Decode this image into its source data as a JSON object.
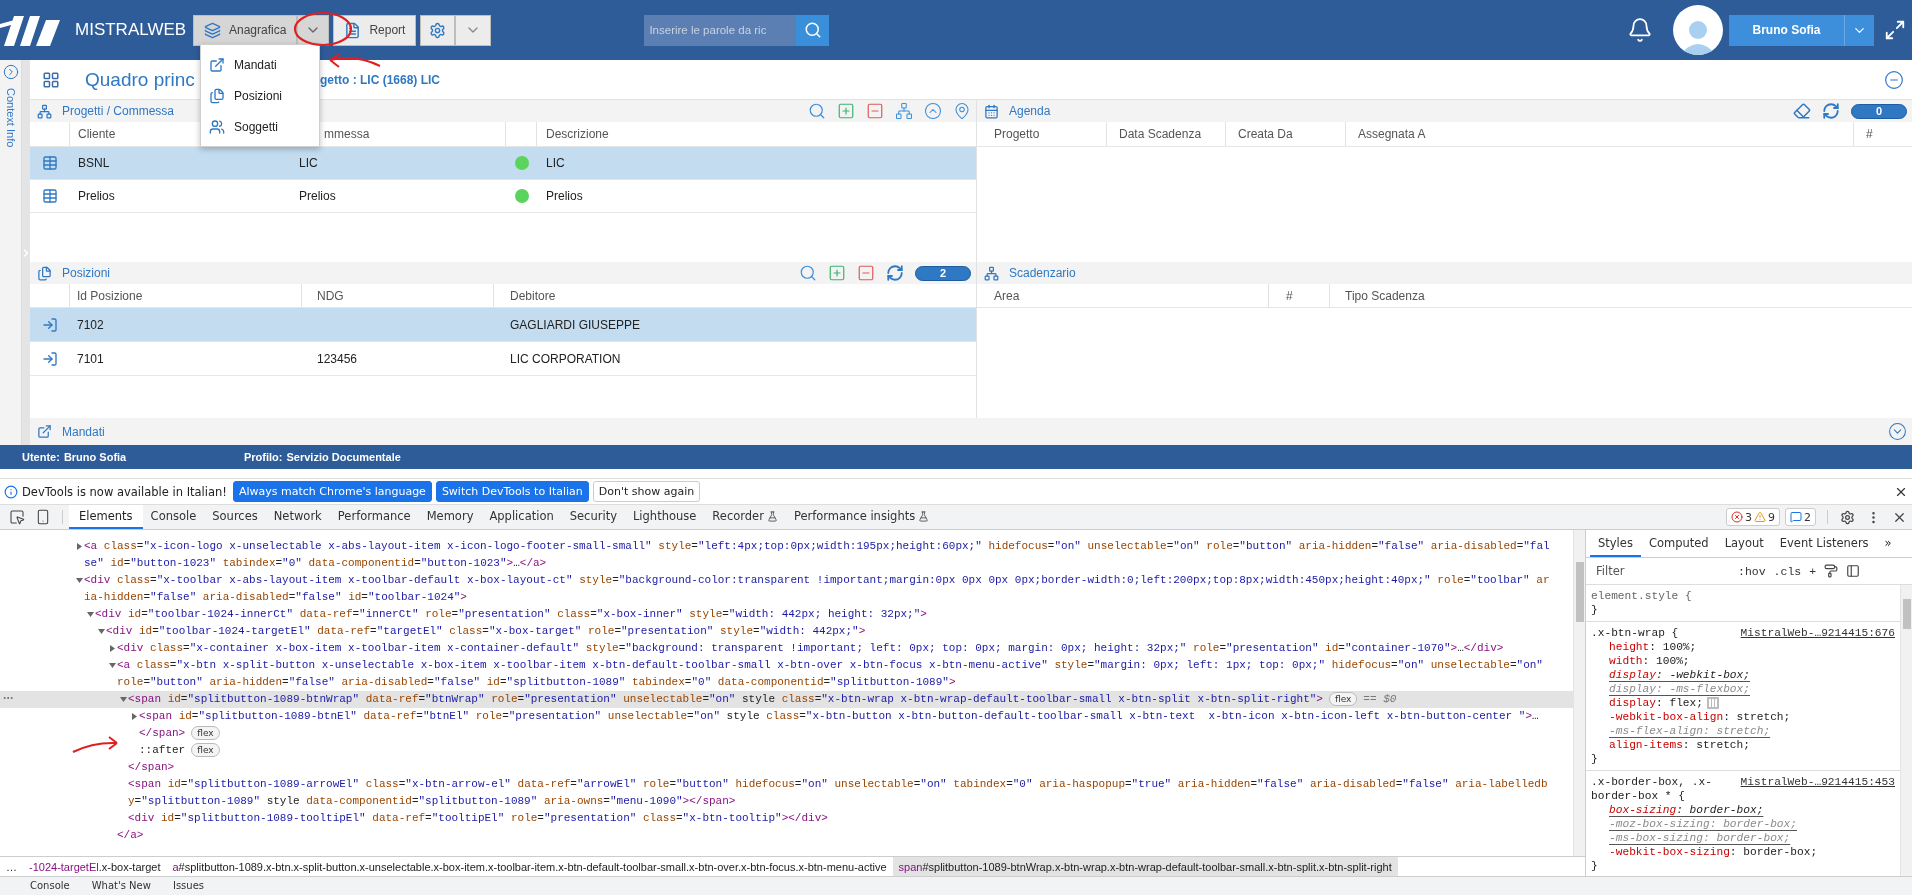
{
  "header": {
    "brand": "MISTRALWEB",
    "anagrafica": {
      "label": "Anagrafica",
      "open": true,
      "items": [
        {
          "label": "Mandati",
          "kind": "mandate"
        },
        {
          "label": "Posizioni",
          "kind": "position"
        },
        {
          "label": "Soggetti",
          "kind": "people"
        }
      ]
    },
    "report": {
      "label": "Report"
    },
    "search": {
      "placeholder": "Inserire le parole da ric"
    },
    "user": {
      "label": "Bruno Sofia"
    }
  },
  "sidebar": {
    "label": "Context Info"
  },
  "title": {
    "text": "Quadro princ",
    "context": "getto : LIC (1668) LIC"
  },
  "projects": {
    "title": "Progetti / Commessa",
    "columns": [
      "Cliente",
      "mmessa",
      "Descrizione"
    ],
    "rows": [
      {
        "cliente": "BSNL",
        "commessa": "LIC",
        "color": "#5ad45a",
        "descrizione": "LIC",
        "selected": true
      },
      {
        "cliente": "Prelios",
        "commessa": "Prelios",
        "color": "#5ad45a",
        "descrizione": "Prelios",
        "selected": false
      }
    ]
  },
  "agenda": {
    "title": "Agenda",
    "count": "0",
    "columns": [
      "Progetto",
      "Data Scadenza",
      "Creata Da",
      "Assegnata A",
      "#"
    ]
  },
  "positions": {
    "title": "Posizioni",
    "count": "2",
    "columns": [
      "Id Posizione",
      "NDG",
      "Debitore"
    ],
    "rows": [
      {
        "id": "7102",
        "debitore": "GAGLIARDI GIUSEPPE",
        "selected": true
      },
      {
        "id": "7101",
        "ndg": "123456",
        "debitore": "LIC CORPORATION",
        "selected": false
      }
    ]
  },
  "deadlines": {
    "title": "Scadenzario",
    "columns": [
      "Area",
      "#",
      "Tipo Scadenza"
    ]
  },
  "mandates": {
    "title": "Mandati",
    "expanded": false
  },
  "status_bar": {
    "user_label": "Utente:",
    "user": "Bruno Sofia",
    "profile_label": "Profilo:",
    "profile": "Servizio Documentale"
  },
  "devtools": {
    "infobar": {
      "message": "DevTools is now available in Italian!",
      "buttons": [
        {
          "label": "Always match Chrome's language",
          "kind": "primary"
        },
        {
          "label": "Switch DevTools to Italian",
          "kind": "primary"
        },
        {
          "label": "Don't show again",
          "kind": "plain"
        }
      ]
    },
    "tabs": [
      {
        "label": "Elements",
        "selected": true,
        "experimental": false
      },
      {
        "label": "Console",
        "selected": false,
        "experimental": false
      },
      {
        "label": "Sources",
        "selected": false,
        "experimental": false
      },
      {
        "label": "Network",
        "selected": false,
        "experimental": false
      },
      {
        "label": "Performance",
        "selected": false,
        "experimental": false
      },
      {
        "label": "Memory",
        "selected": false,
        "experimental": false
      },
      {
        "label": "Application",
        "selected": false,
        "experimental": false
      },
      {
        "label": "Security",
        "selected": false,
        "experimental": false
      },
      {
        "label": "Lighthouse",
        "selected": false,
        "experimental": false
      },
      {
        "label": "Recorder",
        "selected": false,
        "experimental": true
      },
      {
        "label": "Performance insights",
        "selected": false,
        "experimental": true
      }
    ],
    "errors": "3",
    "warnings": "9",
    "messages": "2",
    "tree": [
      {
        "markup": "<a class=\"x-icon-logo x-unselectable x-abs-layout-item x-icon-logo-footer-small-small\" style=\"left:4px;top:0px;width:195px;height:60px;\" hidefocus=\"on\" unselectable=\"on\" role=\"button\" aria-hidden=\"false\" aria-disabled=\"false\" id=\"button-1023\" tabindex=\"0\" data-componentid=\"button-1023\">…</a>",
        "expanded": false,
        "selected": false
      },
      {
        "markup": "<div class=\"x-toolbar x-abs-layout-item x-toolbar-default x-box-layout-ct\" style=\"background-color:transparent !important;margin:0px 0px 0px 0px;border-width:0;left:200px;top:8px;width:450px;height:40px;\" role=\"toolbar\" aria-hidden=\"false\" aria-disabled=\"false\" id=\"toolbar-1024\">",
        "expanded": true,
        "selected": false,
        "children": [
          {
            "markup": "<div id=\"toolbar-1024-innerCt\" data-ref=\"innerCt\" role=\"presentation\" class=\"x-box-inner\" style=\"width: 442px; height: 32px;\">",
            "expanded": true,
            "selected": false,
            "children": [
              {
                "markup": "<div id=\"toolbar-1024-targetEl\" data-ref=\"targetEl\" class=\"x-box-target\" role=\"presentation\" style=\"width: 442px;\">",
                "expanded": true,
                "selected": false,
                "children": [
                  {
                    "markup": "<div class=\"x-container x-box-item x-toolbar-item x-container-default\" style=\"background: transparent !important; left: 0px; top: 0px; margin: 0px; height: 32px;\" role=\"presentation\" id=\"container-1070\">…</div>",
                    "expanded": false,
                    "selected": false
                  },
                  {
                    "markup": "<a class=\"x-btn x-split-button x-unselectable x-box-item x-toolbar-item x-btn-default-toolbar-small x-btn-over x-btn-focus x-btn-menu-active\" style=\"margin: 0px; left: 1px; top: 0px;\" hidefocus=\"on\" unselectable=\"on\" role=\"button\" aria-hidden=\"false\" aria-disabled=\"false\" id=\"splitbutton-1089\" tabindex=\"0\" data-componentid=\"splitbutton-1089\">",
                    "expanded": true,
                    "selected": false,
                    "close": "</a>",
                    "children": [
                      {
                        "markup": "<span id=\"splitbutton-1089-btnWrap\" data-ref=\"btnWrap\" role=\"presentation\" unselectable=\"on\" style class=\"x-btn-wrap x-btn-wrap-default-toolbar-small x-btn-split x-btn-split-right\">",
                        "expanded": true,
                        "selected": true,
                        "badge": "flex",
                        "note": "== $0",
                        "close": "</span>",
                        "children": [
                          {
                            "markup": "<span id=\"splitbutton-1089-btnEl\" data-ref=\"btnEl\" role=\"presentation\" unselectable=\"on\" style class=\"x-btn-button x-btn-button-default-toolbar-small x-btn-text  x-btn-icon x-btn-icon-left x-btn-button-center \">…",
                            "close": "</span>",
                            "expanded": false,
                            "selected": false,
                            "badge": "flex"
                          },
                          {
                            "markup": "::after",
                            "selected": false,
                            "badge": "flex",
                            "annotated": true
                          }
                        ]
                      },
                      {
                        "markup": "<span id=\"splitbutton-1089-arrowEl\" class=\"x-btn-arrow-el\" data-ref=\"arrowEl\" role=\"button\" hidefocus=\"on\" unselectable=\"on\" tabindex=\"0\" aria-haspopup=\"true\" aria-hidden=\"false\" aria-disabled=\"false\" aria-labelledby=\"splitbutton-1089\" style data-componentid=\"splitbutton-1089\" aria-owns=\"menu-1090\"></span>",
                        "selected": false
                      },
                      {
                        "markup": "<div id=\"splitbutton-1089-tooltipEl\" data-ref=\"tooltipEl\" role=\"presentation\" class=\"x-btn-tooltip\"></div>",
                        "selected": false
                      }
                    ]
                  }
                ]
              }
            ]
          }
        ]
      }
    ],
    "breadcrumbs": [
      {
        "text": "…",
        "selected": false
      },
      {
        "text": "-1024-targetEl.x-box-target",
        "selected": false
      },
      {
        "text": "a#splitbutton-1089.x-btn.x-split-button.x-unselectable.x-box-item.x-toolbar-item.x-btn-default-toolbar-small.x-btn-over.x-btn-focus.x-btn-menu-active",
        "selected": false
      },
      {
        "text": "span#splitbutton-1089-btnWrap.x-btn-wrap.x-btn-wrap-default-toolbar-small.x-btn-split.x-btn-split-right",
        "selected": true
      }
    ],
    "styles": {
      "tabs": [
        {
          "label": "Styles",
          "selected": true
        },
        {
          "label": "Computed",
          "selected": false
        },
        {
          "label": "Layout",
          "selected": false
        },
        {
          "label": "Event Listeners",
          "selected": false
        }
      ],
      "more": "»",
      "filter_placeholder": "Filter",
      "hov": ":hov",
      "cls": ".cls",
      "add": "+",
      "rules": [
        {
          "selector": "element.style {",
          "close": "}",
          "kind": "inline"
        },
        {
          "selector": ".x-btn-wrap {",
          "source": "MistralWeb-…9214415:676",
          "close": "}",
          "kind": "sheet",
          "props": [
            {
              "name": "height",
              "value": ": 100%;",
              "struck": false,
              "dimmed": false
            },
            {
              "name": "width",
              "value": ": 100%;",
              "struck": false,
              "dimmed": false
            },
            {
              "name": "display",
              "value": ": -webkit-box;",
              "struck": true,
              "dimmed": false
            },
            {
              "name": "display",
              "value": ": -ms-flexbox;",
              "struck": true,
              "dimmed": true
            },
            {
              "name": "display",
              "value": ": flex;",
              "struck": false,
              "dimmed": false,
              "flex_editor": true
            },
            {
              "name": "-webkit-box-align",
              "value": ": stretch;",
              "struck": false,
              "dimmed": false
            },
            {
              "name": "-ms-flex-align",
              "value": ": stretch;",
              "struck": true,
              "dimmed": true
            },
            {
              "name": "align-items",
              "value": ": stretch;",
              "struck": false,
              "dimmed": false
            }
          ]
        },
        {
          "selector": ".x-border-box, .x-border-box * {",
          "source": "MistralWeb-…9214415:453",
          "close": "}",
          "kind": "sheet",
          "props": [
            {
              "name": "box-sizing",
              "value": ": border-box;",
              "struck": true,
              "dimmed": false
            },
            {
              "name": "-moz-box-sizing",
              "value": ": border-box;",
              "struck": true,
              "dimmed": true
            },
            {
              "name": "-ms-box-sizing",
              "value": ": border-box;",
              "struck": true,
              "dimmed": true
            },
            {
              "name": "-webkit-box-sizing",
              "value": ": border-box;",
              "struck": false,
              "dimmed": false
            }
          ]
        }
      ]
    },
    "drawer": [
      {
        "label": "Console"
      },
      {
        "label": "What's New"
      },
      {
        "label": "Issues"
      }
    ]
  }
}
